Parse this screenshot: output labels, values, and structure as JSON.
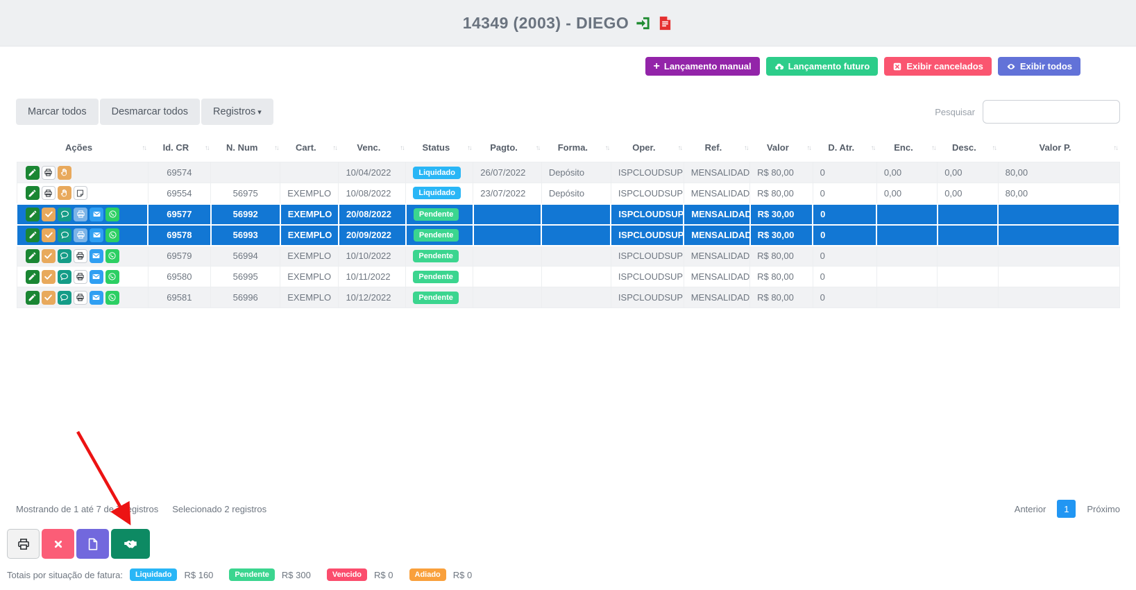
{
  "page": {
    "title": "14349 (2003) - DIEGO",
    "title_icons": [
      "sign-in-icon",
      "invoice-icon"
    ]
  },
  "toolbar": {
    "buttons": [
      {
        "name": "lancamento-manual",
        "label": "Lançamento manual",
        "icon": "plus-icon",
        "color": "#9324a9"
      },
      {
        "name": "lancamento-futuro",
        "label": "Lançamento futuro",
        "icon": "cloud-upload-icon",
        "color": "#2dcd8a"
      },
      {
        "name": "exibir-cancelados",
        "label": "Exibir cancelados",
        "icon": "cancel-square-icon",
        "color": "#fa5570"
      },
      {
        "name": "exibir-todos",
        "label": "Exibir todos",
        "icon": "eye-icon",
        "color": "#6272d8"
      }
    ]
  },
  "controls": {
    "marcar_todos": "Marcar todos",
    "desmarcar_todos": "Desmarcar todos",
    "registros": "Registros",
    "search_label": "Pesquisar",
    "search_value": ""
  },
  "table": {
    "columns": [
      "Ações",
      "Id. CR",
      "N. Num",
      "Cart.",
      "Venc.",
      "Status",
      "Pagto.",
      "Forma.",
      "Oper.",
      "Ref.",
      "Valor",
      "D. Atr.",
      "Enc.",
      "Desc.",
      "Valor P."
    ],
    "status_colors": {
      "Liquidado": "#29b6f6",
      "Pendente": "#3bd58f"
    },
    "selected_row_color": "#1277d4",
    "rows": [
      {
        "selected": false,
        "striped": true,
        "actions": [
          "edit-icon",
          "print-icon",
          "hand-icon"
        ],
        "cells": {
          "id_cr": "69574",
          "n_num": "",
          "cart": "",
          "venc": "10/04/2022",
          "status": "Liquidado",
          "pagto": "26/07/2022",
          "forma": "Depósito",
          "oper": "ISPCLOUDSUP",
          "ref": "MENSALIDADE",
          "valor": "R$ 80,00",
          "d_atr": "0",
          "enc": "0,00",
          "desc": "0,00",
          "valor_p": "80,00"
        }
      },
      {
        "selected": false,
        "striped": false,
        "actions": [
          "edit-icon",
          "print-icon",
          "hand-icon",
          "note-icon"
        ],
        "cells": {
          "id_cr": "69554",
          "n_num": "56975",
          "cart": "EXEMPLO",
          "venc": "10/08/2022",
          "status": "Liquidado",
          "pagto": "23/07/2022",
          "forma": "Depósito",
          "oper": "ISPCLOUDSUP",
          "ref": "MENSALIDADE",
          "valor": "R$ 80,00",
          "d_atr": "0",
          "enc": "0,00",
          "desc": "0,00",
          "valor_p": "80,00"
        }
      },
      {
        "selected": true,
        "striped": false,
        "actions": [
          "edit-icon",
          "check-icon",
          "comments-icon",
          "print-icon",
          "mail-icon",
          "whatsapp-icon"
        ],
        "cells": {
          "id_cr": "69577",
          "n_num": "56992",
          "cart": "EXEMPLO",
          "venc": "20/08/2022",
          "status": "Pendente",
          "pagto": "",
          "forma": "",
          "oper": "ISPCLOUDSUP",
          "ref": "MENSALIDADE",
          "valor": "R$ 30,00",
          "d_atr": "0",
          "enc": "",
          "desc": "",
          "valor_p": ""
        }
      },
      {
        "selected": true,
        "striped": false,
        "actions": [
          "edit-icon",
          "check-icon",
          "comments-icon",
          "print-icon",
          "mail-icon",
          "whatsapp-icon"
        ],
        "cells": {
          "id_cr": "69578",
          "n_num": "56993",
          "cart": "EXEMPLO",
          "venc": "20/09/2022",
          "status": "Pendente",
          "pagto": "",
          "forma": "",
          "oper": "ISPCLOUDSUP",
          "ref": "MENSALIDADE",
          "valor": "R$ 30,00",
          "d_atr": "0",
          "enc": "",
          "desc": "",
          "valor_p": ""
        }
      },
      {
        "selected": false,
        "striped": true,
        "actions": [
          "edit-icon",
          "check-icon",
          "comments-icon",
          "print-icon",
          "mail-icon",
          "whatsapp-icon"
        ],
        "cells": {
          "id_cr": "69579",
          "n_num": "56994",
          "cart": "EXEMPLO",
          "venc": "10/10/2022",
          "status": "Pendente",
          "pagto": "",
          "forma": "",
          "oper": "ISPCLOUDSUP",
          "ref": "MENSALIDADE",
          "valor": "R$ 80,00",
          "d_atr": "0",
          "enc": "",
          "desc": "",
          "valor_p": ""
        }
      },
      {
        "selected": false,
        "striped": false,
        "actions": [
          "edit-icon",
          "check-icon",
          "comments-icon",
          "print-icon",
          "mail-icon",
          "whatsapp-icon"
        ],
        "cells": {
          "id_cr": "69580",
          "n_num": "56995",
          "cart": "EXEMPLO",
          "venc": "10/11/2022",
          "status": "Pendente",
          "pagto": "",
          "forma": "",
          "oper": "ISPCLOUDSUP",
          "ref": "MENSALIDADE",
          "valor": "R$ 80,00",
          "d_atr": "0",
          "enc": "",
          "desc": "",
          "valor_p": ""
        }
      },
      {
        "selected": false,
        "striped": true,
        "actions": [
          "edit-icon",
          "check-icon",
          "comments-icon",
          "print-icon",
          "mail-icon",
          "whatsapp-icon"
        ],
        "cells": {
          "id_cr": "69581",
          "n_num": "56996",
          "cart": "EXEMPLO",
          "venc": "10/12/2022",
          "status": "Pendente",
          "pagto": "",
          "forma": "",
          "oper": "ISPCLOUDSUP",
          "ref": "MENSALIDADE",
          "valor": "R$ 80,00",
          "d_atr": "0",
          "enc": "",
          "desc": "",
          "valor_p": ""
        }
      }
    ]
  },
  "footer": {
    "showing": "Mostrando de 1 até 7 de 7 registros",
    "selected_info": "Selecionado 2 registros",
    "anterior": "Anterior",
    "page": "1",
    "proximo": "Próximo"
  },
  "bottom_toolbar": {
    "buttons": [
      {
        "name": "print",
        "icon": "printer-icon",
        "color": "#f2f2f2"
      },
      {
        "name": "cancel",
        "icon": "x-icon",
        "color": "#fb5d77"
      },
      {
        "name": "document",
        "icon": "file-icon",
        "color": "#7268dd"
      },
      {
        "name": "settle",
        "icon": "handshake-icon",
        "color": "#0d8a63"
      }
    ]
  },
  "totals": {
    "label": "Totais por situação de fatura:",
    "items": [
      {
        "status": "Liquidado",
        "value": "R$ 160",
        "color": "#29b6f6"
      },
      {
        "status": "Pendente",
        "value": "R$ 300",
        "color": "#3bd58f"
      },
      {
        "status": "Vencido",
        "value": "R$ 0",
        "color": "#fb4d6d"
      },
      {
        "status": "Adiado",
        "value": "R$ 0",
        "color": "#f9a03c"
      }
    ]
  },
  "annotation": {
    "arrow_color": "#ec1313"
  }
}
